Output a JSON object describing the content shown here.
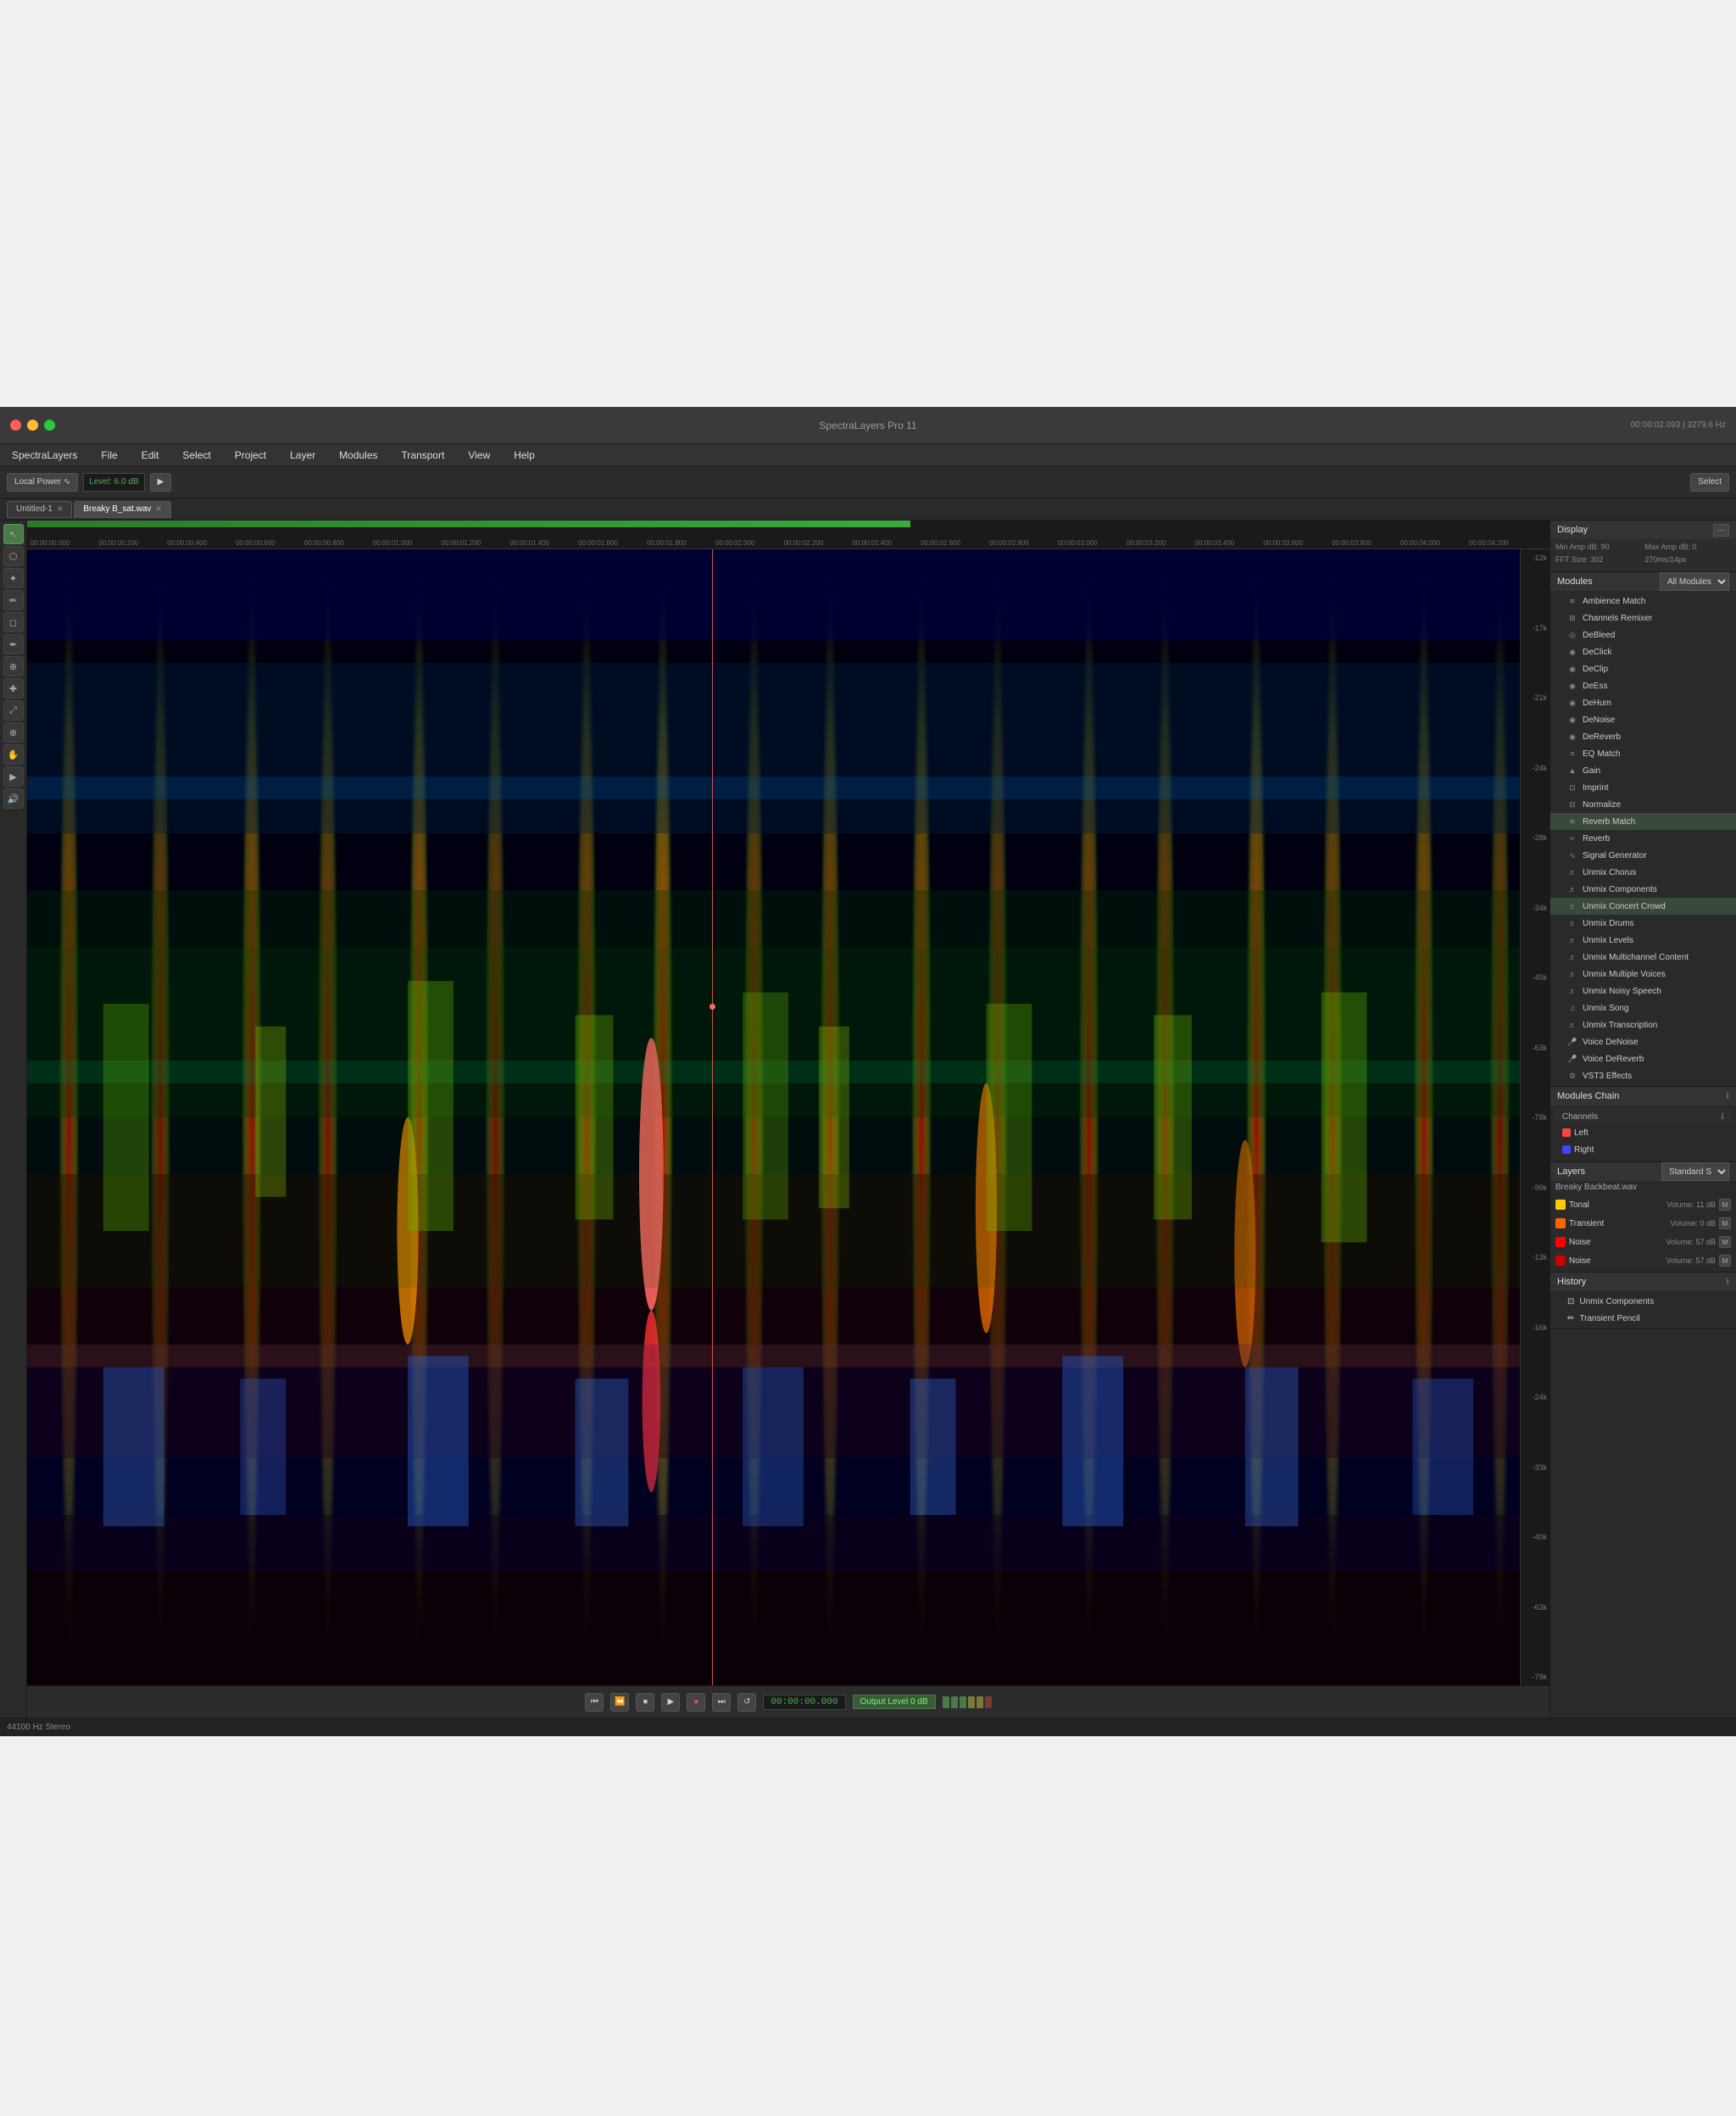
{
  "app": {
    "title": "SpectraLayers Pro 11",
    "status_bar": "44100 Hz Stereo"
  },
  "title_bar": {
    "app_name": "SpectraLayers",
    "time_display": "00:00:02.093 | 3279.6 Hz",
    "title": "SpectraLayers Pro 11"
  },
  "menu": {
    "items": [
      "SpectraLayers",
      "File",
      "Edit",
      "Select",
      "Project",
      "Layer",
      "Modules",
      "Transport",
      "View",
      "Help"
    ]
  },
  "toolbar": {
    "local_power_label": "Local Power ∿",
    "level_label": "Level: 6.0 dB",
    "select_label": "Select",
    "arrow_label": "▶"
  },
  "tabs": [
    {
      "label": "Untitled-1",
      "active": false,
      "modified": true
    },
    {
      "label": "Breaky B_sat.wav",
      "active": true,
      "modified": false
    }
  ],
  "display_section": {
    "title": "Display",
    "fields": {
      "min_amp": "Min Amp dB: 90",
      "max_amp": "Max Amp dB: 0",
      "fft_size": "FFT Size: 302",
      "overlap": "270ms/14px"
    }
  },
  "modules": {
    "title": "Modules",
    "dropdown": "All Modules",
    "items": [
      {
        "label": "Ambience Match",
        "icon": "wave"
      },
      {
        "label": "Channels Remixer",
        "icon": "channel"
      },
      {
        "label": "DeBleed",
        "icon": "de"
      },
      {
        "label": "DeClick",
        "icon": "de"
      },
      {
        "label": "DeClip",
        "icon": "de"
      },
      {
        "label": "DeEss",
        "icon": "de"
      },
      {
        "label": "DeHum",
        "icon": "de"
      },
      {
        "label": "DeNoise",
        "icon": "de"
      },
      {
        "label": "DeReverb",
        "icon": "de"
      },
      {
        "label": "EQ Match",
        "icon": "eq"
      },
      {
        "label": "Gain",
        "icon": "gain"
      },
      {
        "label": "Imprint",
        "icon": "imp"
      },
      {
        "label": "Normalize",
        "icon": "norm"
      },
      {
        "label": "Reverb Match",
        "icon": "rev"
      },
      {
        "label": "Reverb",
        "icon": "rev"
      },
      {
        "label": "Signal Generator",
        "icon": "sig"
      },
      {
        "label": "Unmix Chorus",
        "icon": "unmix"
      },
      {
        "label": "Unmix Components",
        "icon": "unmix"
      },
      {
        "label": "Unmix Concert Crowd",
        "icon": "unmix"
      },
      {
        "label": "Unmix Drums",
        "icon": "unmix"
      },
      {
        "label": "Unmix Levels",
        "icon": "unmix"
      },
      {
        "label": "Unmix Multichannel Content",
        "icon": "unmix"
      },
      {
        "label": "Unmix Multiple Voices",
        "icon": "unmix"
      },
      {
        "label": "Unmix Noisy Speech",
        "icon": "unmix"
      },
      {
        "label": "Unmix Song",
        "icon": "unmix"
      },
      {
        "label": "Unmix Transcription",
        "icon": "unmix"
      },
      {
        "label": "Voice DeNoise",
        "icon": "voice"
      },
      {
        "label": "Voice DeReverb",
        "icon": "voice"
      },
      {
        "label": "VST3 Effects",
        "icon": "vst"
      }
    ]
  },
  "modules_chain": {
    "title": "Modules Chain"
  },
  "channels": {
    "title": "Channels",
    "items": [
      {
        "label": "Left",
        "color": "#ff4444"
      },
      {
        "label": "Right",
        "color": "#4444ff"
      }
    ]
  },
  "layers": {
    "title": "Layers",
    "dropdown": "Standard Size",
    "file": "Breaky Backbeat.wav",
    "items": [
      {
        "label": "Tonal",
        "color": "#ffcc00",
        "size": "Volume: 11 dB"
      },
      {
        "label": "Transient",
        "color": "#ff6600",
        "size": "Volume: 0 dB"
      },
      {
        "label": "Noise",
        "color": "#ff0000",
        "size": "Volume: 57 dB"
      },
      {
        "label": "Noise",
        "color": "#ff0000",
        "size": "Volume: 57 dB"
      }
    ]
  },
  "history": {
    "title": "History",
    "items": [
      {
        "label": "Unmix Components"
      },
      {
        "label": "Transient Pencil"
      }
    ]
  },
  "transport": {
    "time": "00:00:00.000",
    "output_label": "Output Level",
    "db_value": "0 dB"
  },
  "time_ruler": {
    "ticks": [
      "00:00:00.000",
      "00:00:00.200",
      "00:00:00.400",
      "00:00:00.600",
      "00:00:00.800",
      "00:00:01.000",
      "00:00:01.200",
      "00:00:01.400",
      "00:00:01.600",
      "00:00:01.800",
      "00:00:02.000",
      "00:00:02.200",
      "00:00:02.400",
      "00:00:02.600",
      "00:00:02.800",
      "00:00:03.000",
      "00:00:03.200",
      "00:00:03.400",
      "00:00:03.600",
      "00:00:03.800",
      "00:00:04.000",
      "00:00:04.200"
    ]
  },
  "db_scale": {
    "values": [
      "-12k",
      "-17k",
      "-21k",
      "-24k",
      "-28k",
      "-34k",
      "-45k",
      "-63k",
      "-78k",
      "-99k",
      "-13k",
      "-16k",
      "-24k",
      "-33k",
      "-40k",
      "-63k",
      "-79k"
    ]
  }
}
